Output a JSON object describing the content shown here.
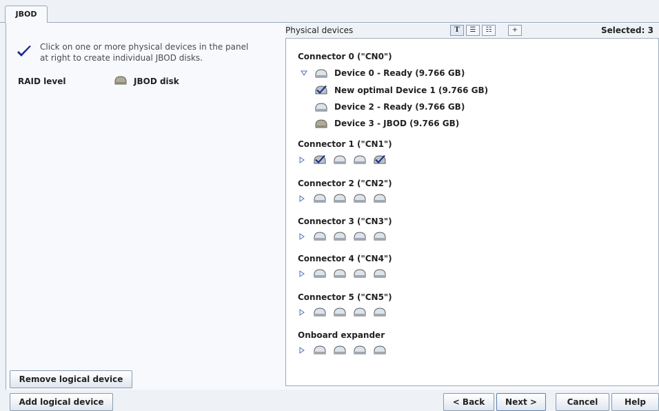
{
  "tab": {
    "label": "JBOD"
  },
  "left_panel": {
    "instruction": "Click on one or more physical devices in the panel at right to create individual JBOD disks.",
    "raid_label": "RAID level",
    "raid_value": "JBOD disk",
    "remove_button": "Remove logical device"
  },
  "right_panel": {
    "title": "Physical devices",
    "selected": "Selected: 3",
    "toolbar": [
      {
        "icon": "text-view-icon",
        "glyph": "T"
      },
      {
        "icon": "list-view-icon",
        "glyph": "☰"
      },
      {
        "icon": "tree-view-icon",
        "glyph": "☷"
      },
      {
        "icon": "expand-icon",
        "glyph": "+"
      }
    ],
    "connectors": [
      {
        "label": "Connector 0 (\"CN0\")",
        "expanded": true,
        "devices": [
          {
            "label": "Device 0 - Ready (9.766 GB)",
            "state": "ready"
          },
          {
            "label": "New optimal  Device 1 (9.766 GB)",
            "state": "selected"
          },
          {
            "label": "Device 2 - Ready (9.766 GB)",
            "state": "ready"
          },
          {
            "label": "Device 3 - JBOD (9.766 GB)",
            "state": "jbod"
          }
        ]
      },
      {
        "label": "Connector 1 (\"CN1\")",
        "expanded": false,
        "disks": [
          "selected",
          "ready",
          "ready",
          "selected"
        ]
      },
      {
        "label": "Connector 2 (\"CN2\")",
        "expanded": false,
        "disks": [
          "ready",
          "ready",
          "ready",
          "ready"
        ]
      },
      {
        "label": "Connector 3 (\"CN3\")",
        "expanded": false,
        "disks": [
          "ready",
          "ready",
          "ready",
          "ready"
        ]
      },
      {
        "label": "Connector 4 (\"CN4\")",
        "expanded": false,
        "disks": [
          "ready",
          "ready",
          "ready",
          "ready"
        ]
      },
      {
        "label": "Connector 5 (\"CN5\")",
        "expanded": false,
        "disks": [
          "ready",
          "ready",
          "ready",
          "ready"
        ]
      },
      {
        "label": "Onboard expander",
        "expanded": false,
        "disks": [
          "ready",
          "ready",
          "ready",
          "ready"
        ]
      }
    ]
  },
  "footer": {
    "add_button": "Add logical device",
    "back_button": "< Back",
    "next_button": "Next >",
    "cancel_button": "Cancel",
    "help_button": "Help"
  },
  "colors": {
    "background": "#eef2f7",
    "panel": "#f7f9fc",
    "border": "#99a7bb",
    "check": "#1a2a8c"
  }
}
